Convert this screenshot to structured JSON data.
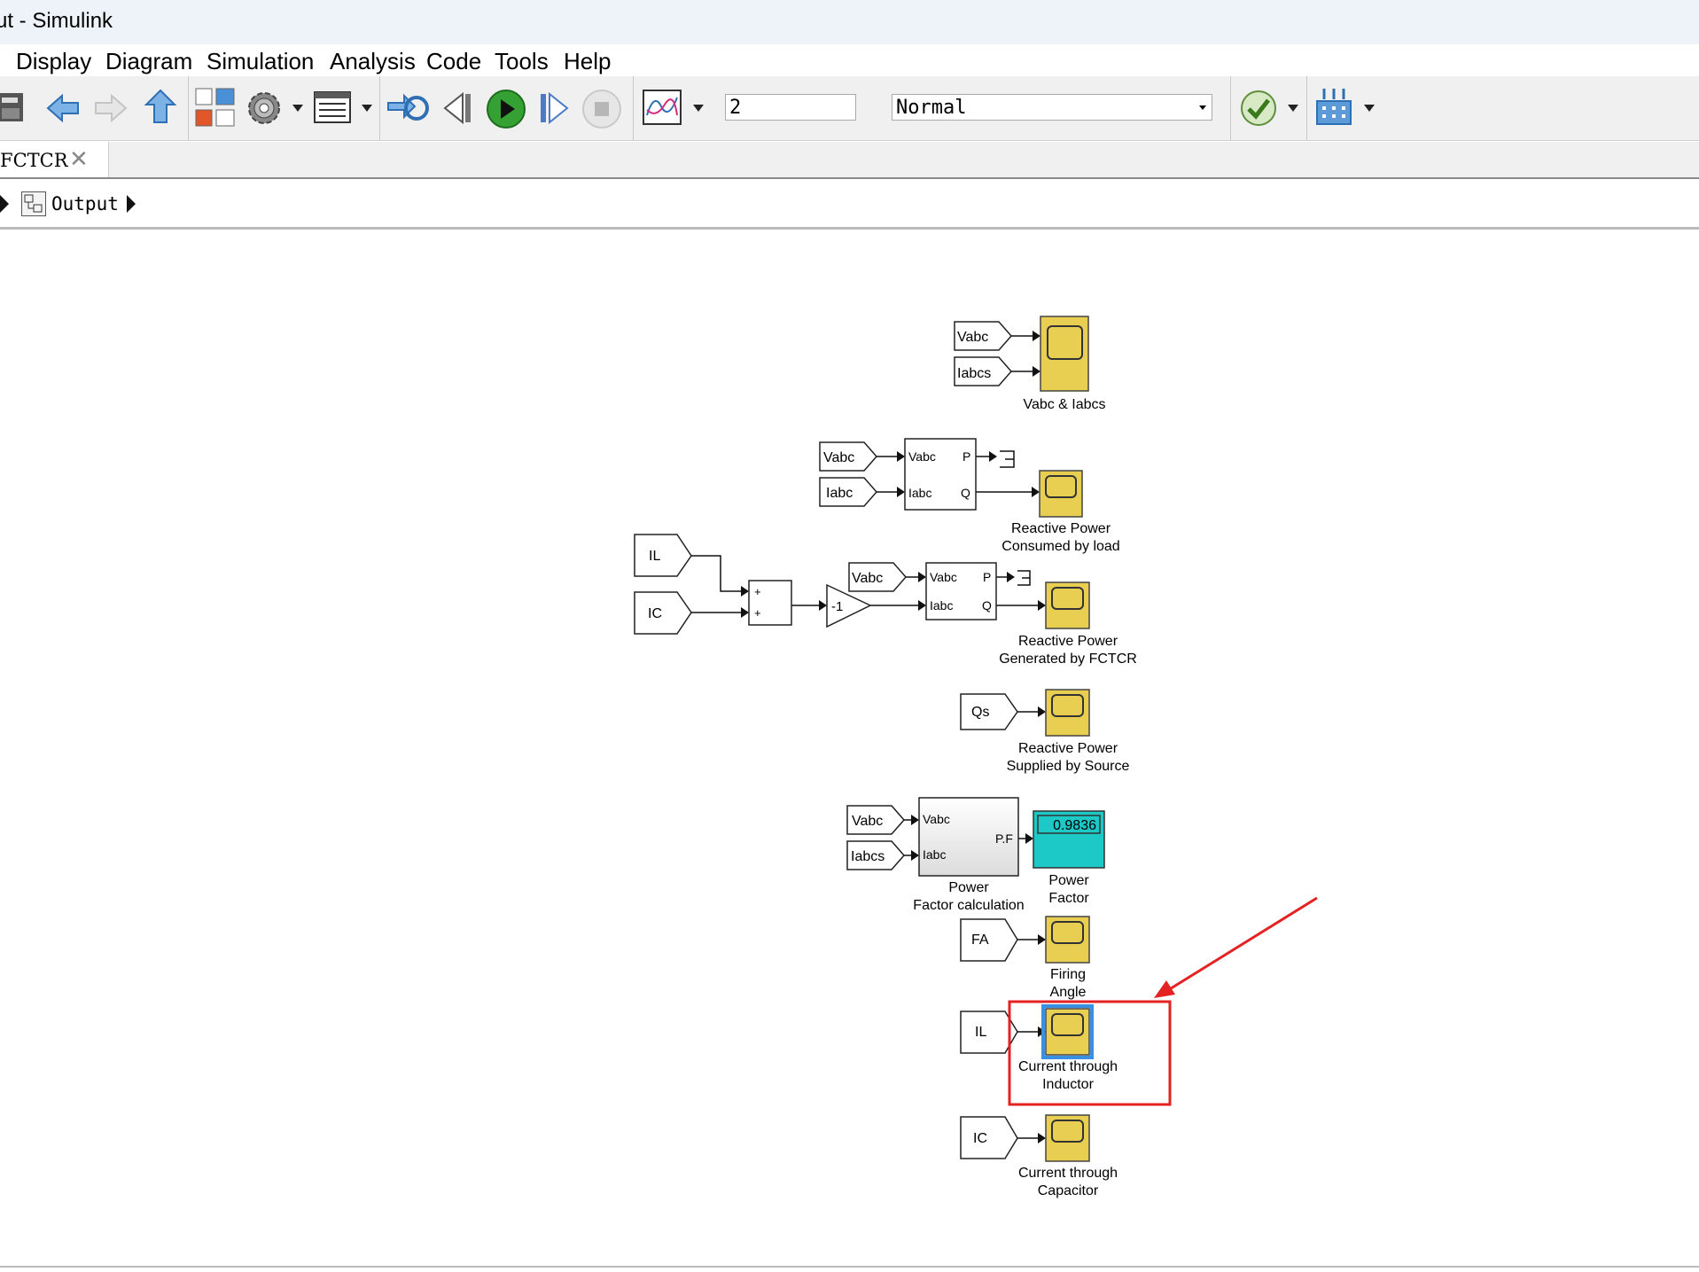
{
  "window": {
    "title": "ut - Simulink"
  },
  "menu": [
    "Display",
    "Diagram",
    "Simulation",
    "Analysis",
    "Code",
    "Tools",
    "Help"
  ],
  "toolbar": {
    "stop_time": "2",
    "sim_mode": "Normal",
    "icons": [
      "save-icon",
      "back-arrow-icon",
      "forward-arrow-icon",
      "up-arrow-icon",
      "library-browser-icon",
      "model-config-gear-icon",
      "model-explorer-icon",
      "update-diagram-icon",
      "step-back-icon",
      "run-icon",
      "step-forward-icon",
      "stop-icon",
      "data-inspector-icon",
      "model-advisor-check-icon",
      "build-icon"
    ]
  },
  "tab": {
    "label": "FCTCR",
    "close": "✕"
  },
  "breadcrumb": {
    "label": "Output"
  },
  "diagram": {
    "scope1": {
      "in1": "Vabc",
      "in2": "Iabcs",
      "label": "Vabc & Iabcs"
    },
    "pq1": {
      "in1": "Vabc",
      "in2": "Iabc",
      "port_vabc": "Vabc",
      "port_iabc": "Iabc",
      "port_p": "P",
      "port_q": "Q",
      "scope_l1": "Reactive Power",
      "scope_l2": "Consumed by load"
    },
    "sum": {
      "in1": "IL",
      "in2": "IC",
      "sign1": "+",
      "sign2": "+",
      "gain": "-1"
    },
    "pq2": {
      "in1": "Vabc",
      "port_vabc": "Vabc",
      "port_iabc": "Iabc",
      "port_p": "P",
      "port_q": "Q",
      "scope_l1": "Reactive Power",
      "scope_l2": "Generated by FCTCR"
    },
    "qs": {
      "in": "Qs",
      "scope_l1": "Reactive Power",
      "scope_l2": "Supplied by Source"
    },
    "pf": {
      "in1": "Vabc",
      "in2": "Iabcs",
      "port_vabc": "Vabc",
      "port_iabc": "Iabc",
      "port_out": "P.F",
      "block_l1": "Power",
      "block_l2": "Factor calculation",
      "display_value": "0.9836",
      "display_l1": "Power",
      "display_l2": "Factor"
    },
    "fa": {
      "in": "FA",
      "scope_l1": "Firing",
      "scope_l2": "Angle"
    },
    "il": {
      "in": "IL",
      "scope_l1": "Current through",
      "scope_l2": "Inductor"
    },
    "ic": {
      "in": "IC",
      "scope_l1": "Current through",
      "scope_l2": "Capacitor"
    }
  },
  "colors": {
    "scope": "#e8cf52",
    "display": "#1cc9c6",
    "annotation": "#e42222",
    "selection": "#3b8fe0"
  }
}
